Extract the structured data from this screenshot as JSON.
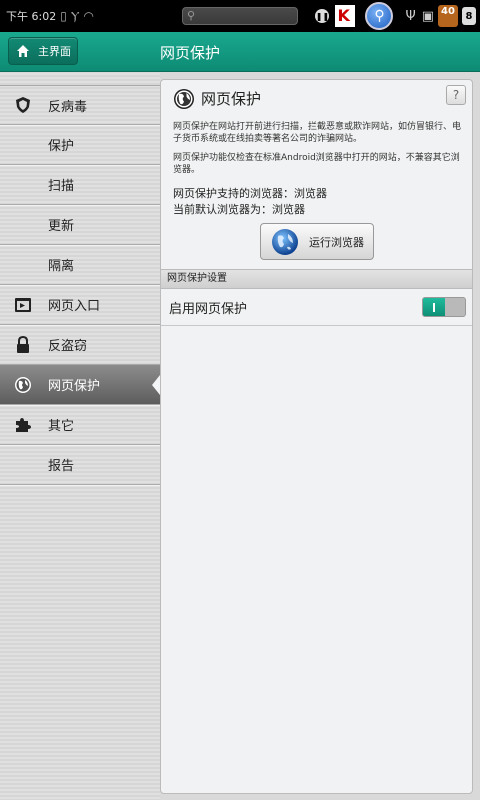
{
  "statusbar": {
    "time": "下午 6:02",
    "badge_count": "40",
    "notif_count": "8"
  },
  "header": {
    "home_label": "主界面",
    "title": "网页保护"
  },
  "sidebar": {
    "items": [
      {
        "label": "反病毒",
        "icon": "shield-icon"
      },
      {
        "label": "保护",
        "icon": ""
      },
      {
        "label": "扫描",
        "icon": ""
      },
      {
        "label": "更新",
        "icon": ""
      },
      {
        "label": "隔离",
        "icon": ""
      },
      {
        "label": "网页入口",
        "icon": "browser-window-icon"
      },
      {
        "label": "反盗窃",
        "icon": "lock-icon"
      },
      {
        "label": "网页保护",
        "icon": "globe-icon",
        "active": true
      },
      {
        "label": "其它",
        "icon": "puzzle-icon"
      },
      {
        "label": "报告",
        "icon": ""
      }
    ]
  },
  "panel": {
    "title": "网页保护",
    "help": "?",
    "desc1": "网页保护在网站打开前进行扫描，拦截恶意或欺诈网站，如仿冒银行、电子货币系统或在线拍卖等著名公司的诈骗网站。",
    "desc2": "网页保护功能仅检查在标准Android浏览器中打开的网站，不兼容其它浏览器。",
    "supported": "网页保护支持的浏览器：浏览器",
    "default": "当前默认浏览器为：浏览器",
    "run_button": "运行浏览器",
    "section": "网页保护设置",
    "setting_label": "启用网页保护",
    "setting_enabled": true
  },
  "colors": {
    "accent": "#12a088",
    "header_dark": "#0e8b74",
    "sidebar_active": "#6f6f6f"
  }
}
